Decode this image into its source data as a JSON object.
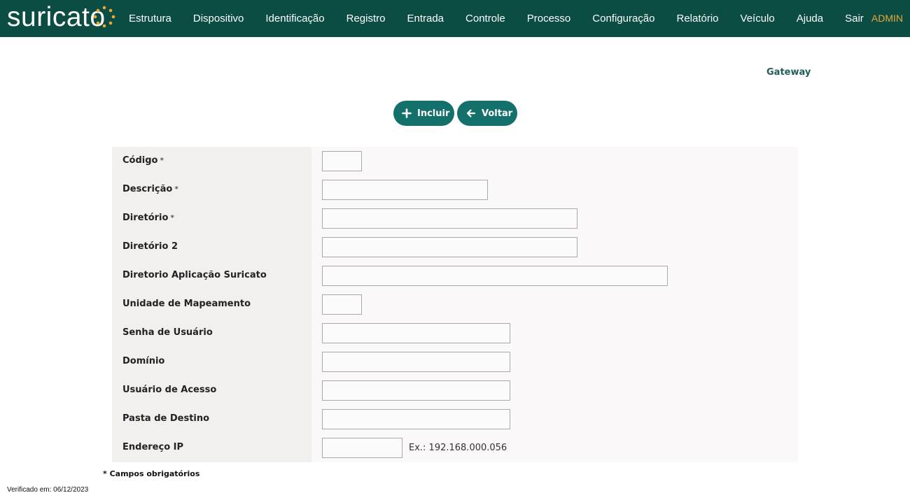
{
  "header": {
    "logo_text": "suricato",
    "logo_icon": "suricato-dots-icon",
    "nav": [
      "Estrutura",
      "Dispositivo",
      "Identificação",
      "Registro",
      "Entrada",
      "Controle",
      "Processo",
      "Configuração",
      "Relatório",
      "Veículo",
      "Ajuda",
      "Sair"
    ],
    "user": "ADMIN",
    "colors": {
      "bar": "#0b4c43",
      "user": "#e8a83a"
    }
  },
  "page": {
    "title": "Gateway"
  },
  "actions": {
    "incluir": {
      "label": "Incluir",
      "icon": "plus-icon"
    },
    "voltar": {
      "label": "Voltar",
      "icon": "arrow-left-icon"
    },
    "color": "#13706a"
  },
  "form": {
    "fields": [
      {
        "label": "Código",
        "required": "*",
        "value": ""
      },
      {
        "label": "Descrição",
        "required": "*",
        "value": ""
      },
      {
        "label": "Diretório",
        "required": "*",
        "value": ""
      },
      {
        "label": "Diretório 2",
        "required": "",
        "value": ""
      },
      {
        "label": "Diretorio Aplicação Suricato",
        "required": "",
        "value": ""
      },
      {
        "label": "Unidade de Mapeamento",
        "required": "",
        "value": ""
      },
      {
        "label": "Senha de Usuário",
        "required": "",
        "value": ""
      },
      {
        "label": "Domínio",
        "required": "",
        "value": ""
      },
      {
        "label": "Usuário de Acesso",
        "required": "",
        "value": ""
      },
      {
        "label": "Pasta de Destino",
        "required": "",
        "value": ""
      },
      {
        "label": "Endereço IP",
        "required": "",
        "value": "",
        "hint": "Ex.: 192.168.000.056"
      }
    ]
  },
  "footer": {
    "required_note": "* Campos obrigatórios",
    "verified": "Verificado em: 06/12/2023"
  }
}
